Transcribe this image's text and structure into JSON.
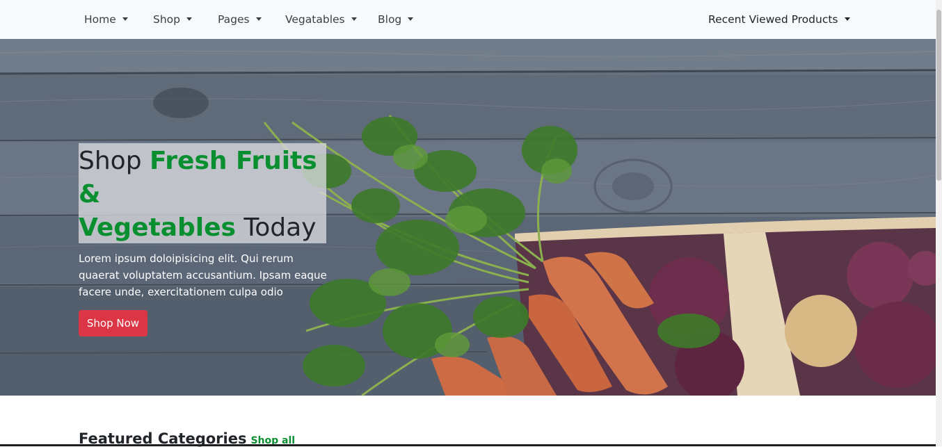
{
  "nav": {
    "items": [
      {
        "label": "Home"
      },
      {
        "label": "Shop"
      },
      {
        "label": "Pages"
      },
      {
        "label": "Vegatables"
      },
      {
        "label": "Blog"
      }
    ],
    "right": {
      "label": "Recent Viewed Products"
    }
  },
  "hero": {
    "title_word1": "Shop",
    "title_green1": "Fresh Fruits &",
    "title_green2": "Vegetables",
    "title_word2": "Today",
    "description": "Lorem ipsum doloipisicing elit. Qui rerum quaerat voluptatem accusantium. Ipsam eaque facere unde, exercitationem culpa odio",
    "button_label": "Shop Now"
  },
  "featured": {
    "title": "Featured Categories",
    "link": "Shop all"
  },
  "colors": {
    "accent_green": "#0a8f30",
    "button_red": "#dc3545",
    "navbar_bg": "#f8f9fa"
  }
}
